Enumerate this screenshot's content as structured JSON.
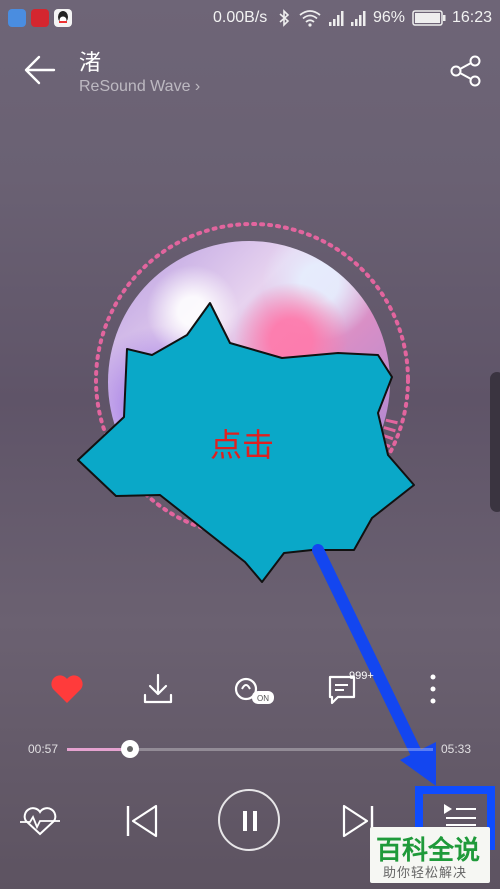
{
  "status_bar": {
    "network_speed": "0.00B/s",
    "battery": "96%",
    "time": "16:23",
    "icons": [
      "shield-app-icon",
      "netease-music-icon",
      "qq-icon",
      "bluetooth-icon",
      "wifi-icon",
      "signal-icon",
      "signal-icon",
      "battery-icon"
    ]
  },
  "header": {
    "song_title": "渚",
    "artist": "ReSound Wave",
    "artist_chevron": "›"
  },
  "annotation": {
    "callout_text": "点击"
  },
  "actions": {
    "comment_count": "999+",
    "liked": true,
    "like_color": "#ff3b3b"
  },
  "progress": {
    "elapsed": "00:57",
    "duration": "05:33",
    "fraction": 0.171
  },
  "watermark": {
    "title": "百科全说",
    "subtitle": "助你轻松解决"
  },
  "colors": {
    "highlight_box": "#0e4cff",
    "arrow": "#1346f0",
    "burst_fill": "#0aa8c8",
    "ring_dots": "#e2659e"
  }
}
